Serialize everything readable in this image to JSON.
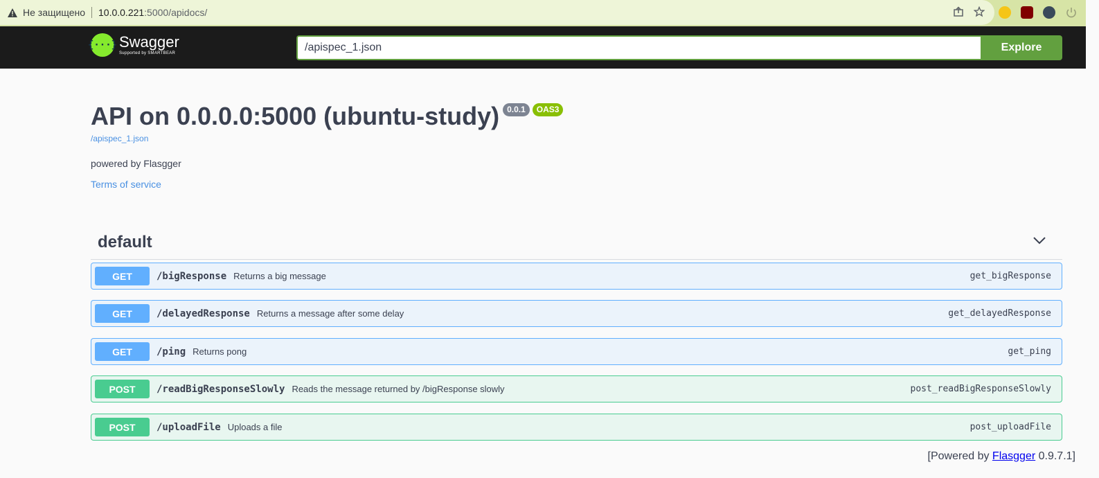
{
  "browser": {
    "security_text": "Не защищено",
    "url_host": "10.0.0.221",
    "url_path": ":5000/apidocs/"
  },
  "topbar": {
    "logo_name": "Swagger",
    "logo_sub": "Supported by SMARTBEAR",
    "logo_glyph": "{···}",
    "spec_url": "/apispec_1.json",
    "explore_label": "Explore"
  },
  "info": {
    "title": "API on 0.0.0.0:5000 (ubuntu-study)",
    "version": "0.0.1",
    "oas": "OAS3",
    "spec_link": "/apispec_1.json",
    "description": "powered by Flasgger",
    "terms": "Terms of service"
  },
  "tag": {
    "name": "default"
  },
  "operations": [
    {
      "method": "GET",
      "path": "/bigResponse",
      "summary": "Returns a big message",
      "opid": "get_bigResponse"
    },
    {
      "method": "GET",
      "path": "/delayedResponse",
      "summary": "Returns a message after some delay",
      "opid": "get_delayedResponse"
    },
    {
      "method": "GET",
      "path": "/ping",
      "summary": "Returns pong",
      "opid": "get_ping"
    },
    {
      "method": "POST",
      "path": "/readBigResponseSlowly",
      "summary": "Reads the message returned by /bigResponse slowly",
      "opid": "post_readBigResponseSlowly"
    },
    {
      "method": "POST",
      "path": "/uploadFile",
      "summary": "Uploads a file",
      "opid": "post_uploadFile"
    }
  ],
  "footer": {
    "prefix": "[Powered by ",
    "link": "Flasgger",
    "suffix": " 0.9.7.1]"
  },
  "colors": {
    "get": "#61affe",
    "post": "#49cc90",
    "explore": "#62a03f"
  }
}
